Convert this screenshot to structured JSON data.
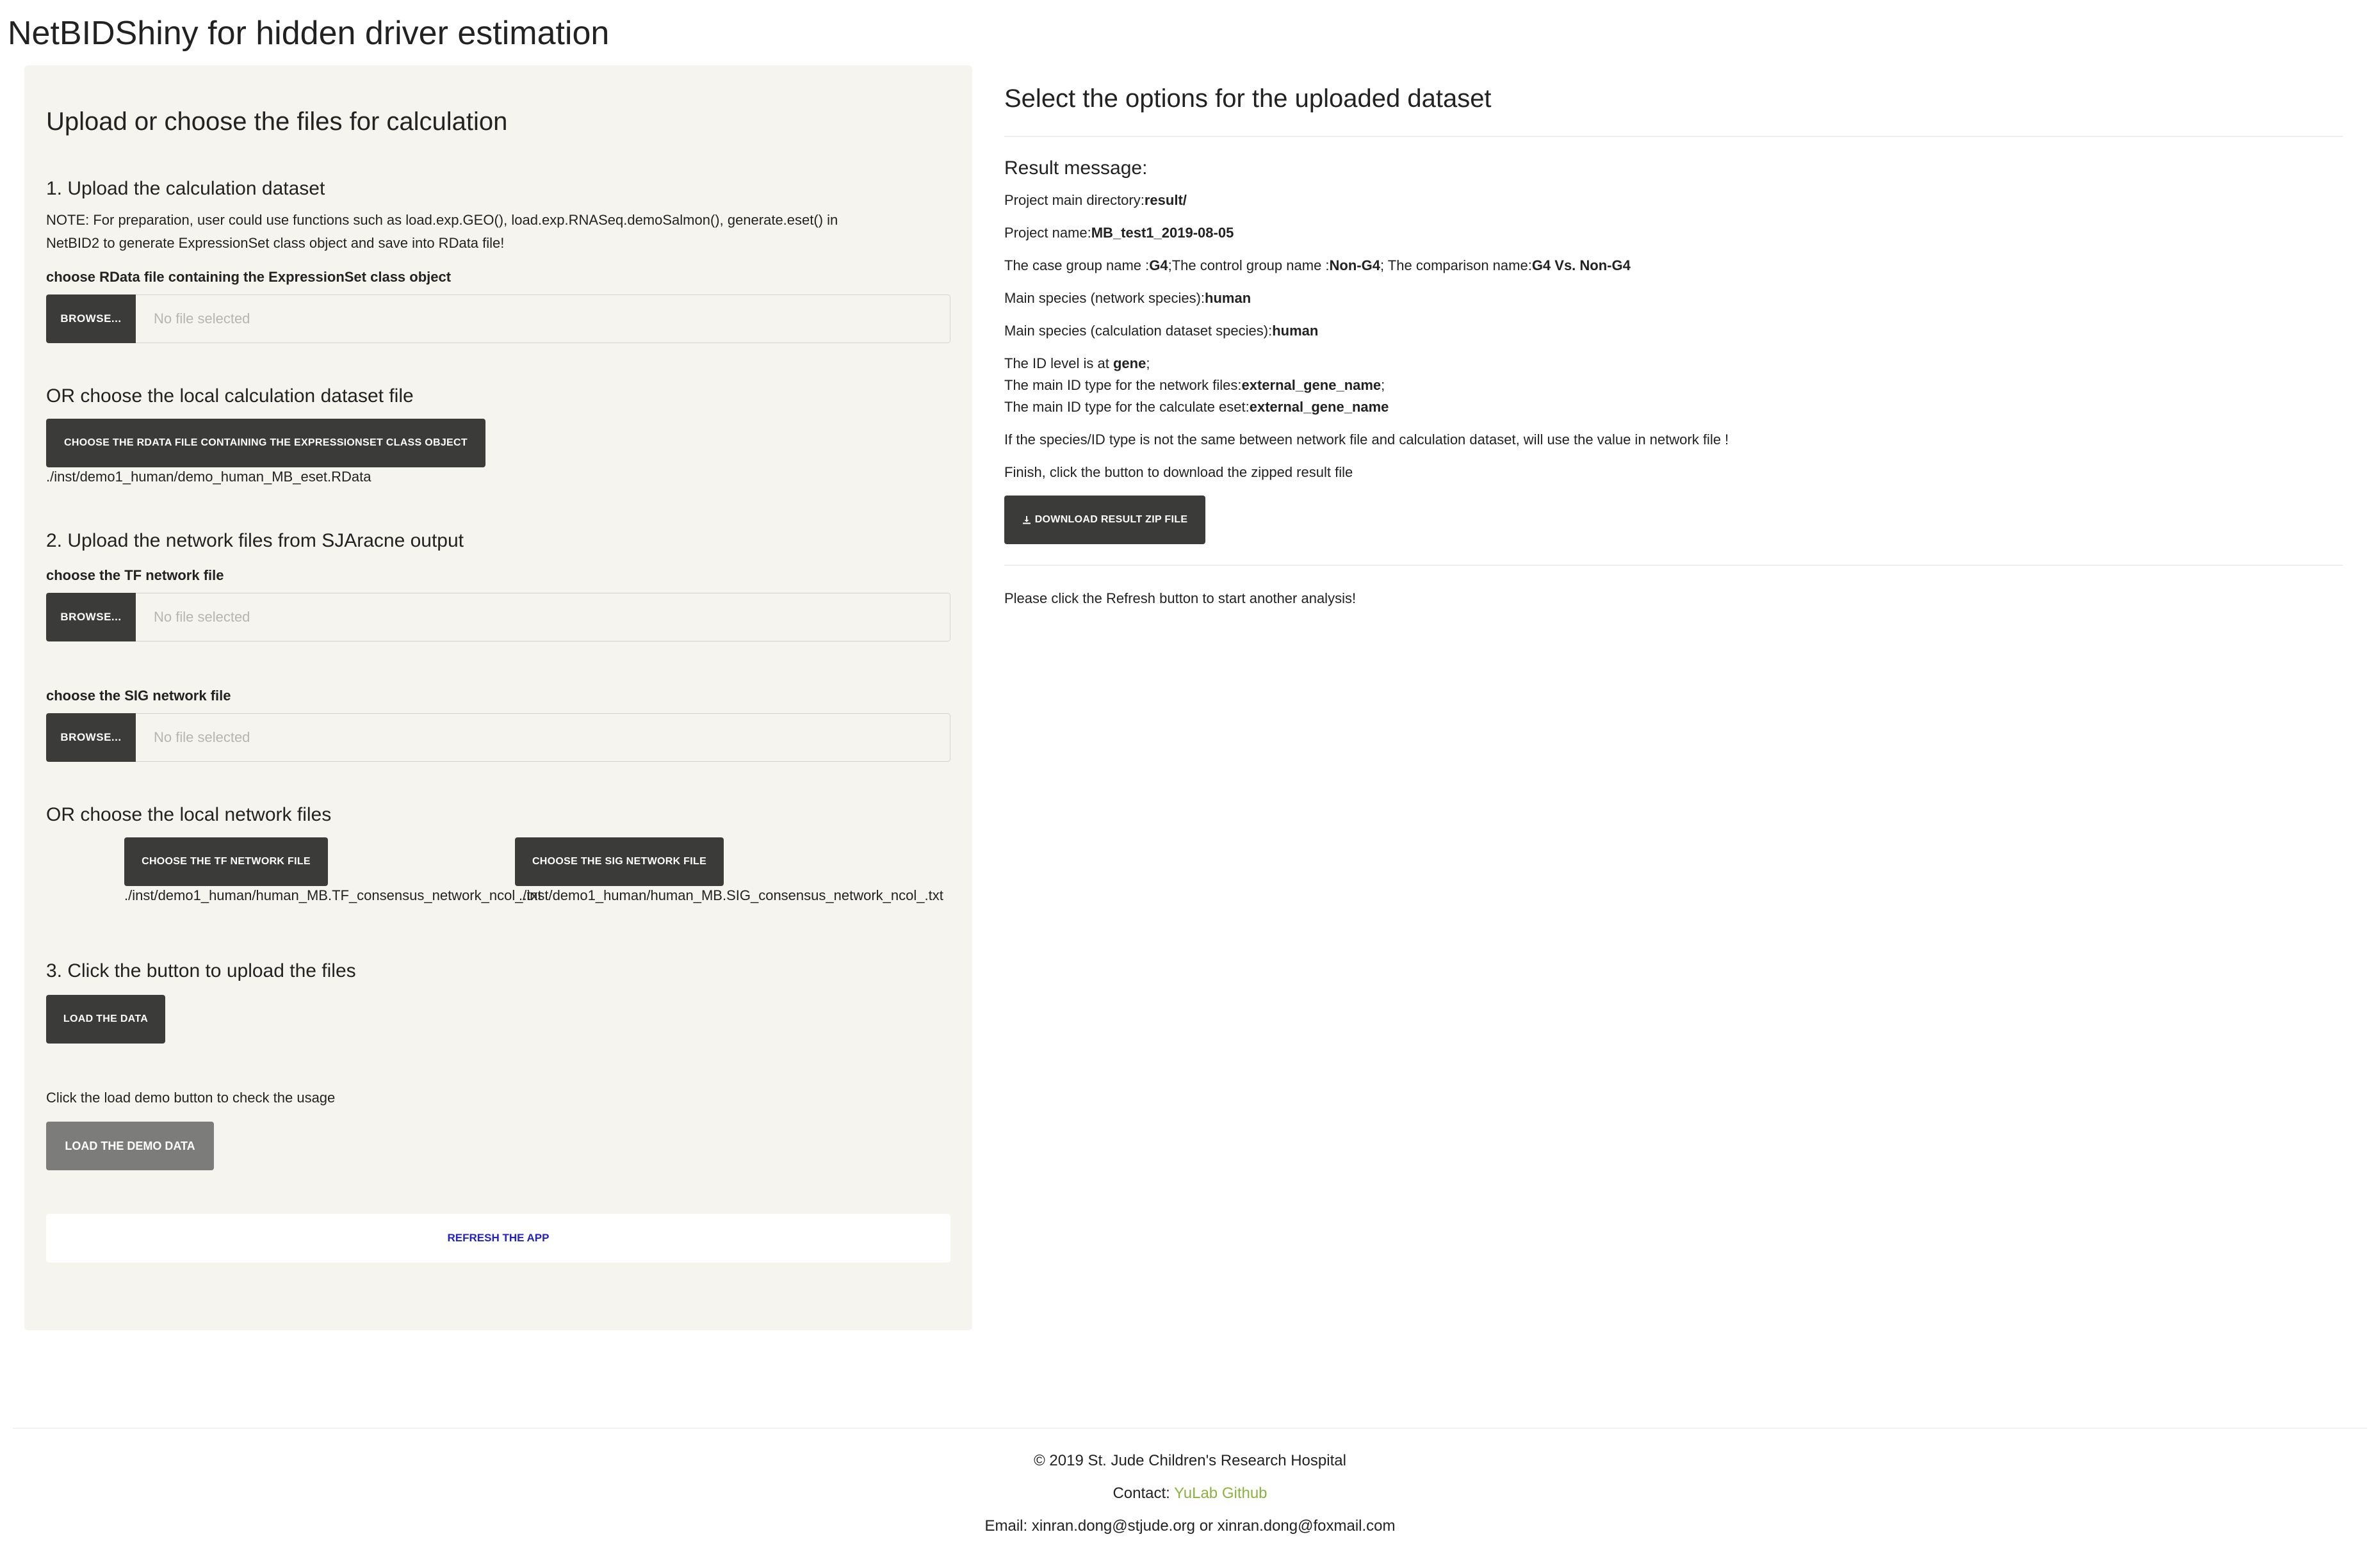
{
  "app": {
    "title": "NetBIDShiny for hidden driver estimation"
  },
  "left_panel": {
    "heading": "Upload or choose the files for calculation",
    "step1": {
      "heading": "1. Upload the calculation dataset",
      "note_line1": "NOTE: For preparation, user could use functions such as load.exp.GEO(), load.exp.RNASeq.demoSalmon(), generate.eset() in",
      "note_line2": "NetBID2 to generate ExpressionSet class object and save into RData file!",
      "file_label": "choose RData file containing the ExpressionSet class object",
      "browse_label": "BROWSE...",
      "file_placeholder": "No file selected",
      "or_heading": "OR choose the local calculation dataset file",
      "choose_button": "CHOOSE THE RDATA FILE CONTAINING THE EXPRESSIONSET CLASS OBJECT",
      "chosen_path": "./inst/demo1_human/demo_human_MB_eset.RData"
    },
    "step2": {
      "heading": "2. Upload the network files from SJAracne output",
      "tf_label": "choose the TF network file",
      "tf_browse": "BROWSE...",
      "tf_placeholder": "No file selected",
      "sig_label": "choose the SIG network file",
      "sig_browse": "BROWSE...",
      "sig_placeholder": "No file selected",
      "or_heading": "OR choose the local network files",
      "tf_button": "CHOOSE THE TF NETWORK FILE",
      "sig_button": "CHOOSE THE SIG NETWORK FILE",
      "tf_path": "./inst/demo1_human/human_MB.TF_consensus_network_ncol_.txt",
      "sig_path": "./inst/demo1_human/human_MB.SIG_consensus_network_ncol_.txt"
    },
    "step3": {
      "heading": "3. Click the button to upload the files",
      "load_button": "LOAD THE DATA",
      "demo_hint": "Click the load demo button to check the usage",
      "demo_button": "LOAD THE DEMO DATA",
      "refresh_button": "REFRESH THE APP"
    }
  },
  "right_panel": {
    "heading": "Select the options for the uploaded dataset",
    "result_title": "Result message:",
    "lines": {
      "dir_label": "Project main directory:",
      "dir_value": "result/",
      "name_label": "Project name:",
      "name_value": "MB_test1_2019-08-05",
      "case_label": "The case group name :",
      "case_value": "G4",
      "control_label": ";The control group name :",
      "control_value": "Non-G4",
      "comparison_label": "; The comparison name:",
      "comparison_value": "G4 Vs. Non-G4",
      "species_net_label": "Main species (network species):",
      "species_net_value": "human",
      "species_calc_label": "Main species (calculation dataset species):",
      "species_calc_value": "human",
      "id_level_label": "The ID level is at ",
      "id_level_value": "gene",
      "id_level_suffix": ";",
      "net_id_label": "The main ID type for the network files:",
      "net_id_value": "external_gene_name",
      "net_id_suffix": ";",
      "eset_id_label": "The main ID type for the calculate eset:",
      "eset_id_value": "external_gene_name",
      "warning": "If the species/ID type is not the same between network file and calculation dataset, will use the value in network file !",
      "finish": "Finish, click the button to download the zipped result file"
    },
    "download_button": "DOWNLOAD RESULT ZIP FILE",
    "refresh_hint": "Please click the Refresh button to start another analysis!"
  },
  "footer": {
    "copyright": "© 2019 St. Jude Children's Research Hospital",
    "contact_label": "Contact: ",
    "contact_link": "YuLab Github",
    "email": "Email: xinran.dong@stjude.org or xinran.dong@foxmail.com"
  },
  "colors": {
    "panel_bg": "#f6f4ef",
    "dark_button": "#3b3b39",
    "grey_button": "#7c7c7b",
    "refresh_text": "#2121c8",
    "link": "#8bb23f"
  }
}
